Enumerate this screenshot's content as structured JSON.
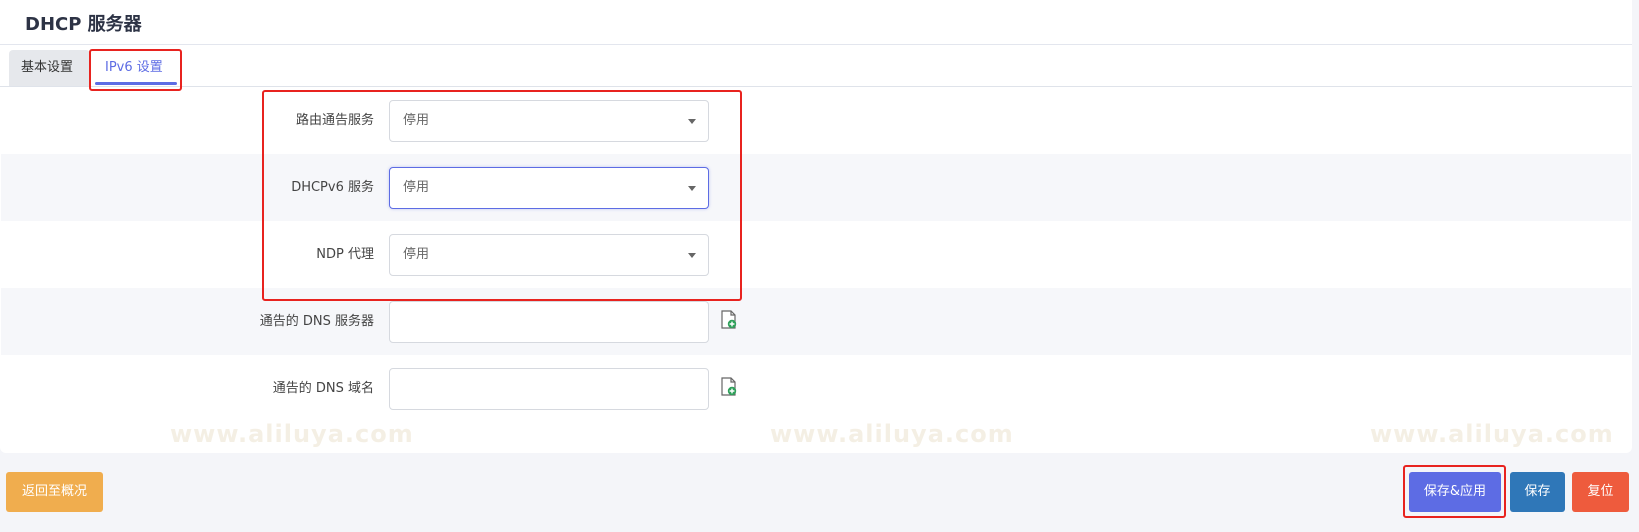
{
  "page": {
    "title": "DHCP 服务器"
  },
  "tabs": [
    {
      "label": "基本设置",
      "active": false
    },
    {
      "label": "IPv6 设置",
      "active": true
    }
  ],
  "fields": {
    "ra_service": {
      "label": "路由通告服务",
      "value": "停用"
    },
    "dhcpv6_service": {
      "label": "DHCPv6 服务",
      "value": "停用"
    },
    "ndp_proxy": {
      "label": "NDP 代理",
      "value": "停用"
    },
    "dns_servers": {
      "label": "通告的 DNS 服务器",
      "value": ""
    },
    "dns_domains": {
      "label": "通告的 DNS 域名",
      "value": ""
    }
  },
  "buttons": {
    "back": "返回至概况",
    "save_apply": "保存&应用",
    "save": "保存",
    "reset": "复位"
  },
  "watermark": {
    "text": "www.aliluya.com"
  },
  "colors": {
    "accent": "#5d6ce4",
    "back_button": "#f0ad4e",
    "save_button": "#2f77b8",
    "reset_button": "#ee5b3d",
    "highlight": "#e8231f"
  }
}
